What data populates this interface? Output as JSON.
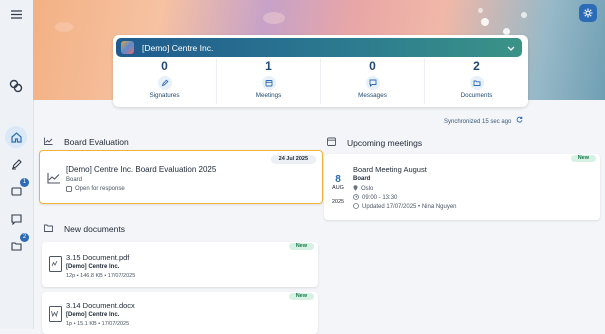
{
  "hero": {
    "company_name": "[Demo] Centre Inc.",
    "stats": [
      {
        "value": "0",
        "label": "Signatures",
        "icon": "pen-icon"
      },
      {
        "value": "1",
        "label": "Meetings",
        "icon": "calendar-icon"
      },
      {
        "value": "0",
        "label": "Messages",
        "icon": "chat-icon"
      },
      {
        "value": "2",
        "label": "Documents",
        "icon": "folder-icon"
      }
    ],
    "sync_text": "Synchronized 15 sec ago"
  },
  "sidebar": {
    "badges": {
      "inbox": "1",
      "folders": "2"
    }
  },
  "board_evaluation": {
    "section_title": "Board Evaluation",
    "item": {
      "title": "[Demo] Centre Inc. Board Evaluation 2025",
      "type": "Board",
      "status": "Open for response",
      "date": "24 Jul 2025"
    }
  },
  "upcoming_meetings": {
    "section_title": "Upcoming meetings",
    "item": {
      "badge": "New",
      "day": "8",
      "month": "AUG",
      "year": "2025",
      "title": "Board Meeting August",
      "body": "Board",
      "location": "Oslo",
      "time": "09:00 - 13:30",
      "updated": "Updated 17/07/2025 • Nina Nguyen"
    }
  },
  "new_documents": {
    "section_title": "New documents",
    "items": [
      {
        "badge": "New",
        "name": "3.15 Document.pdf",
        "company": "[Demo] Centre Inc.",
        "meta": "12p • 146.8 KB • 17/07/2025",
        "icon": "pdf-file-icon"
      },
      {
        "badge": "New",
        "name": "3.14 Document.docx",
        "company": "[Demo] Centre Inc.",
        "meta": "1p • 15.1 KB • 17/07/2025",
        "icon": "word-file-icon"
      }
    ]
  }
}
